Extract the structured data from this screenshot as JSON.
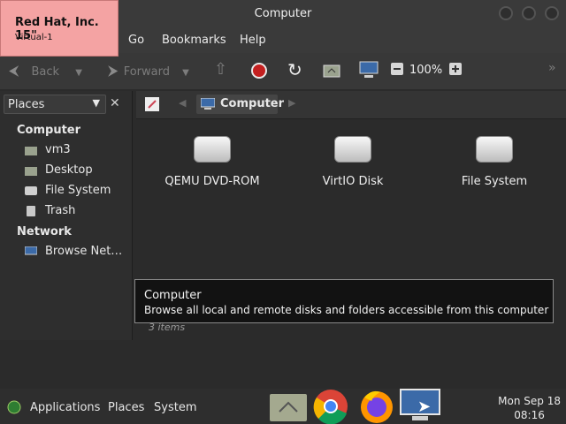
{
  "overlay": {
    "line1": "Red Hat, Inc. 15\"",
    "line2": "Virtual-1"
  },
  "window": {
    "title": "Computer"
  },
  "menubar": {
    "go": "Go",
    "bookmarks": "Bookmarks",
    "help": "Help"
  },
  "toolbar": {
    "back": "Back",
    "forward": "Forward",
    "zoom": "100%"
  },
  "sidebar": {
    "selector": "Places",
    "headings": {
      "computer": "Computer",
      "network": "Network"
    },
    "items": [
      {
        "label": "vm3",
        "icon": "home-folder-icon"
      },
      {
        "label": "Desktop",
        "icon": "desktop-folder-icon"
      },
      {
        "label": "File System",
        "icon": "drive-icon"
      },
      {
        "label": "Trash",
        "icon": "trash-icon"
      }
    ],
    "network_items": [
      {
        "label": "Browse Net…",
        "icon": "network-icon"
      }
    ]
  },
  "pathbar": {
    "crumb": "Computer"
  },
  "drives": [
    {
      "label": "QEMU DVD-ROM",
      "icon": "optical-drive-icon"
    },
    {
      "label": "VirtIO Disk",
      "icon": "hard-disk-icon"
    },
    {
      "label": "File System",
      "icon": "hard-disk-icon"
    }
  ],
  "tooltip": {
    "title": "Computer",
    "body": "Browse all local and remote disks and folders accessible from this computer"
  },
  "status": {
    "text": "3 items"
  },
  "taskbar": {
    "applications": "Applications",
    "places": "Places",
    "system": "System",
    "clock_date": "Mon Sep 18",
    "clock_time": "08:16"
  }
}
